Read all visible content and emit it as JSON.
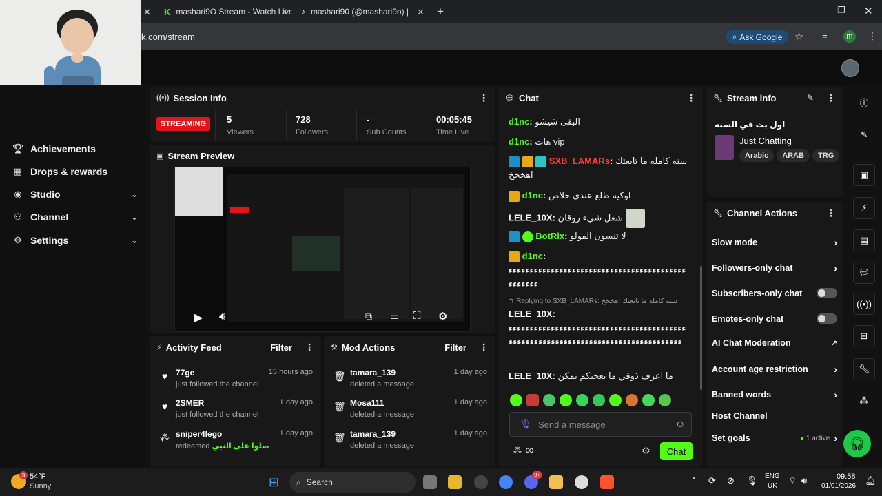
{
  "browser": {
    "tabs": [
      {
        "title": "mashari9O Stream - Watch Live"
      },
      {
        "title": "mashari90 (@mashari9o) | TikTo"
      }
    ],
    "url_text": "k.com/stream",
    "ask_google": "Ask Google",
    "profile_initial": "m",
    "accent": "#53fc18"
  },
  "sidebar": {
    "items": [
      {
        "label": "Achievements",
        "icon": "trophy-icon"
      },
      {
        "label": "Drops & rewards",
        "icon": "gift-icon"
      },
      {
        "label": "Studio",
        "icon": "studio-icon"
      },
      {
        "label": "Channel",
        "icon": "people-icon"
      },
      {
        "label": "Settings",
        "icon": "gear-icon"
      }
    ]
  },
  "session": {
    "title": "Session Info",
    "badge": "STREAMING",
    "stats": [
      {
        "value": "5",
        "label": "Viewers"
      },
      {
        "value": "728",
        "label": "Followers"
      },
      {
        "value": "-",
        "label": "Sub Counts"
      },
      {
        "value": "00:05:45",
        "label": "Time Live"
      }
    ]
  },
  "preview": {
    "title": "Stream Preview"
  },
  "activity": {
    "title": "Activity Feed",
    "filter": "Filter",
    "items": [
      {
        "name": "77ge",
        "sub": "just followed the channel",
        "time": "15 hours ago",
        "highlight": ""
      },
      {
        "name": "2SMER",
        "sub": "just followed the channel",
        "time": "1 day ago",
        "highlight": ""
      },
      {
        "name": "sniper4lego",
        "sub": "redeemed",
        "time": "1 day ago",
        "highlight": "صلوا على النبي"
      }
    ]
  },
  "mod": {
    "title": "Mod Actions",
    "filter": "Filter",
    "items": [
      {
        "name": "tamara_139",
        "sub": "deleted a message",
        "time": "1 day ago"
      },
      {
        "name": "Mosa111",
        "sub": "deleted a message",
        "time": "1 day ago"
      },
      {
        "name": "tamara_139",
        "sub": "deleted a message",
        "time": "1 day ago"
      }
    ]
  },
  "chat": {
    "title": "Chat",
    "messages": [
      {
        "user": "d1nc",
        "text": "البقى شيشو",
        "color": "#53fc18"
      },
      {
        "user": "d1nc",
        "text": "هات vip",
        "color": "#53fc18"
      },
      {
        "user": "SXB_LAMARs",
        "text": "سنه كامله ما تابعتك اهخخخ",
        "color": "#ff3b3b"
      },
      {
        "user": "d1nc",
        "text": "اوكيه طلع عندي خلاص",
        "color": "#53fc18"
      },
      {
        "user": "LELE_10X",
        "text": "شغل شيء روقان",
        "color": "#ffffff"
      },
      {
        "user": "BotRix",
        "text": "لا تنسون الفولو",
        "color": "#53fc18"
      },
      {
        "user": "d1nc",
        "text": "ءءءءءءءءءءءءءءءءءءءءءءءءءءءءءءءءءءءءءءءءءءءءءءءءء",
        "color": "#53fc18"
      },
      {
        "user": "LELE_10X",
        "text": "ءءءءءءءءءءءءءءءءءءءءءءءءءءءءءءءءءءءءءءءءءءءءءءءءءءءءءءءءءءءءءءءءءءءءءءءءءءءءءءءءءءء",
        "color": "#ffffff"
      },
      {
        "user": "LELE_10X",
        "text": "ما اعرف ذوقي ما يعجبكم يمكن",
        "color": "#ffffff"
      }
    ],
    "reply_prefix": "Replying to SXB_LAMARs:",
    "reply_text": "سنه كامله ما تابعتك اهخخخ",
    "placeholder": "Send a message",
    "send_label": "Chat",
    "infinity": "∞"
  },
  "stream_info": {
    "title": "Stream info",
    "stream_title": "اول بث في السنه",
    "category": "Just Chatting",
    "tags": [
      "Arabic",
      "ARAB",
      "TRG"
    ]
  },
  "channel_actions": {
    "title": "Channel Actions",
    "items": [
      {
        "label": "Slow mode",
        "control": "chevron"
      },
      {
        "label": "Followers-only chat",
        "control": "chevron"
      },
      {
        "label": "Subscribers-only chat",
        "control": "toggle"
      },
      {
        "label": "Emotes-only chat",
        "control": "toggle"
      },
      {
        "label": "AI Chat Moderation",
        "control": "external"
      },
      {
        "label": "Account age restriction",
        "control": "chevron"
      },
      {
        "label": "Banned words",
        "control": "chevron"
      },
      {
        "label": "Host Channel",
        "control": "none"
      },
      {
        "label": "Set goals",
        "control": "chevron"
      }
    ],
    "goals_status": "1 active"
  },
  "taskbar": {
    "weather_temp": "54°F",
    "weather_desc": "Sunny",
    "weather_badge": "3",
    "search": "Search",
    "lang1": "ENG",
    "lang2": "UK",
    "time": "09:58",
    "date": "01/01/2026",
    "discord_badge": "9+"
  }
}
